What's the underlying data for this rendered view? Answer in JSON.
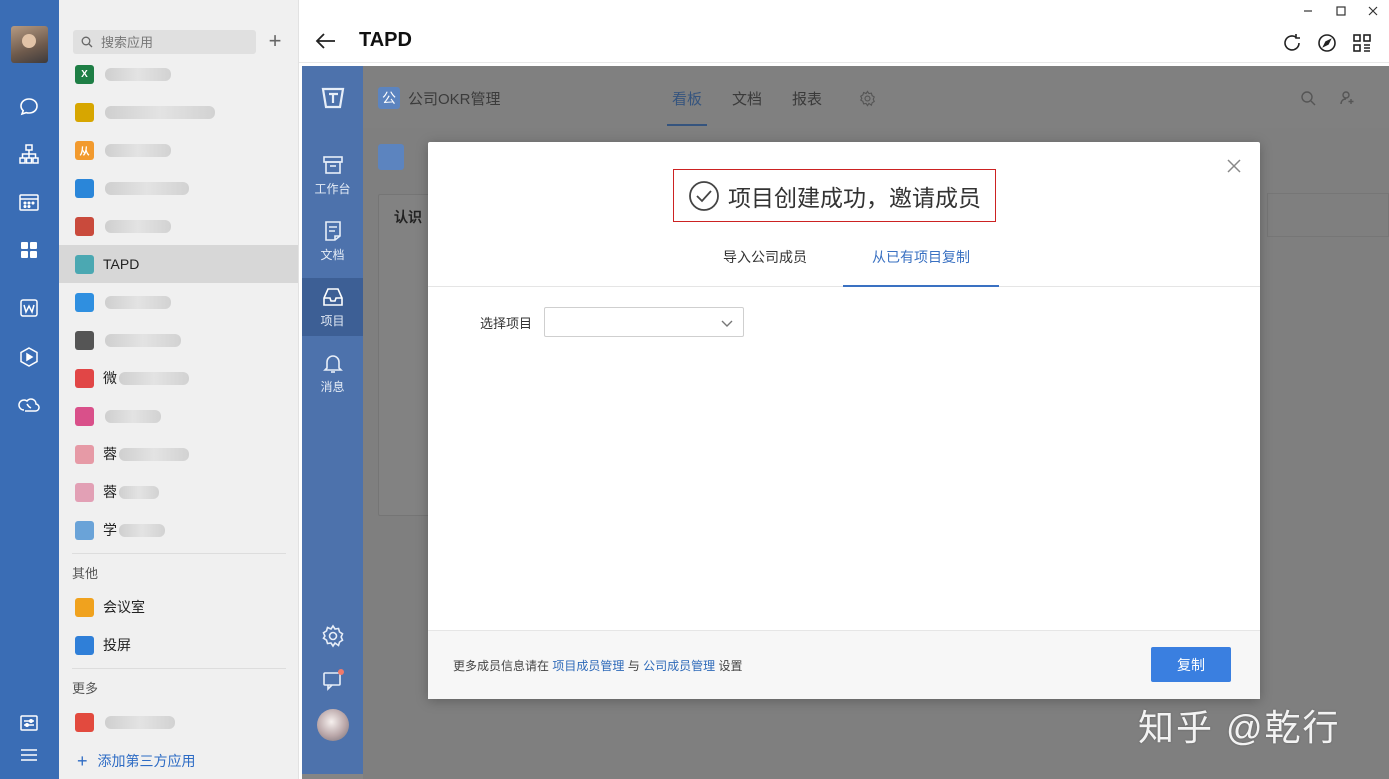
{
  "search": {
    "placeholder": "搜索应用"
  },
  "apps": [
    {
      "label": "",
      "color": "#1e7e45",
      "glyph": "X"
    },
    {
      "label": "",
      "color": "#d7a600",
      "glyph": ""
    },
    {
      "label": "",
      "color": "#f29a2e",
      "glyph": "从"
    },
    {
      "label": "",
      "color": "#2a86d9",
      "glyph": ""
    },
    {
      "label": "",
      "color": "#c94a3c",
      "glyph": ""
    },
    {
      "label": "TAPD",
      "color": "#4ba8b2",
      "glyph": ""
    },
    {
      "label": "",
      "color": "#2f8fe0",
      "glyph": ""
    },
    {
      "label": "",
      "color": "#555555",
      "glyph": ""
    },
    {
      "label": "微",
      "color": "#e14646",
      "glyph": ""
    },
    {
      "label": "",
      "color": "#d9508a",
      "glyph": ""
    },
    {
      "label": "蓉",
      "color": "#e69aa6",
      "glyph": ""
    },
    {
      "label": "蓉",
      "color": "#e2a0b5",
      "glyph": ""
    },
    {
      "label": "学",
      "color": "#6aa3d8",
      "glyph": ""
    }
  ],
  "sections": {
    "other": "其他",
    "more": "更多"
  },
  "other_apps": [
    {
      "label": "会议室",
      "color": "#f0a21e"
    },
    {
      "label": "投屏",
      "color": "#2f7fd8"
    }
  ],
  "more_apps": [
    {
      "label": "",
      "color": "#e24a3e"
    }
  ],
  "add_third": "添加第三方应用",
  "header": {
    "title": "TAPD"
  },
  "tapd_nav": [
    {
      "label": "工作台"
    },
    {
      "label": "文档"
    },
    {
      "label": "项目"
    },
    {
      "label": "消息"
    }
  ],
  "project": {
    "icon_text": "公",
    "name": "公司OKR管理"
  },
  "project_tabs": [
    {
      "label": "看板"
    },
    {
      "label": "文档"
    },
    {
      "label": "报表"
    }
  ],
  "board_column": {
    "header": "认识"
  },
  "modal": {
    "title": "项目创建成功，邀请成员",
    "tabs": [
      {
        "label": "导入公司成员"
      },
      {
        "label": "从已有项目复制"
      }
    ],
    "field_label": "选择项目",
    "select_value": "",
    "footer_prefix": "更多成员信息请在",
    "footer_link1": "项目成员管理",
    "footer_mid": "与",
    "footer_link2": "公司成员管理",
    "footer_suffix": "设置",
    "copy_button": "复制"
  },
  "watermark": "知乎 @乾行",
  "colors": {
    "rail": "#3a6db5",
    "tapd_nav": "#4d72ac",
    "primary": "#3a7fe0",
    "highlight_box": "#cc2222"
  }
}
